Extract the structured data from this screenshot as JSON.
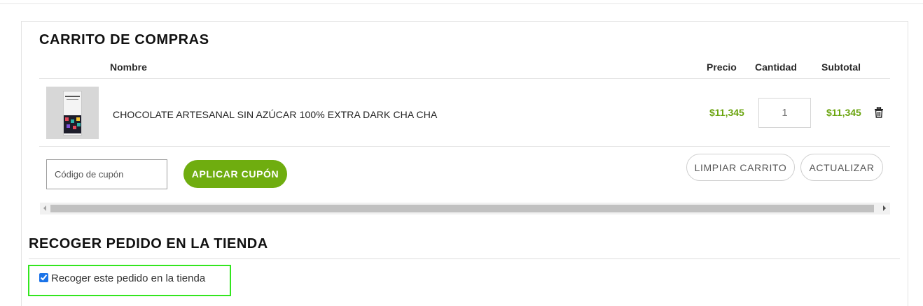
{
  "cart": {
    "title": "CARRITO DE COMPRAS",
    "columns": {
      "name": "Nombre",
      "price": "Precio",
      "quantity": "Cantidad",
      "subtotal": "Subtotal"
    },
    "items": [
      {
        "name": "CHOCOLATE ARTESANAL SIN AZÚCAR 100% EXTRA DARK CHA CHA",
        "price": "$11,345",
        "quantity": "1",
        "subtotal": "$11,345",
        "image_icon": "product-thumbnail",
        "remove_icon": "trash-icon"
      }
    ],
    "coupon": {
      "placeholder": "Código de cupón",
      "value": ""
    },
    "apply_coupon_label": "APLICAR CUPÓN",
    "clear_cart_label": "LIMPIAR CARRITO",
    "update_label": "ACTUALIZAR"
  },
  "pickup": {
    "title": "RECOGER PEDIDO EN LA TIENDA",
    "checkbox_label": "Recoger este pedido en la tienda",
    "checked": true
  },
  "colors": {
    "accent_green": "#6fad0f",
    "price_green": "#6aa40e",
    "highlight_border": "#33e61f"
  }
}
